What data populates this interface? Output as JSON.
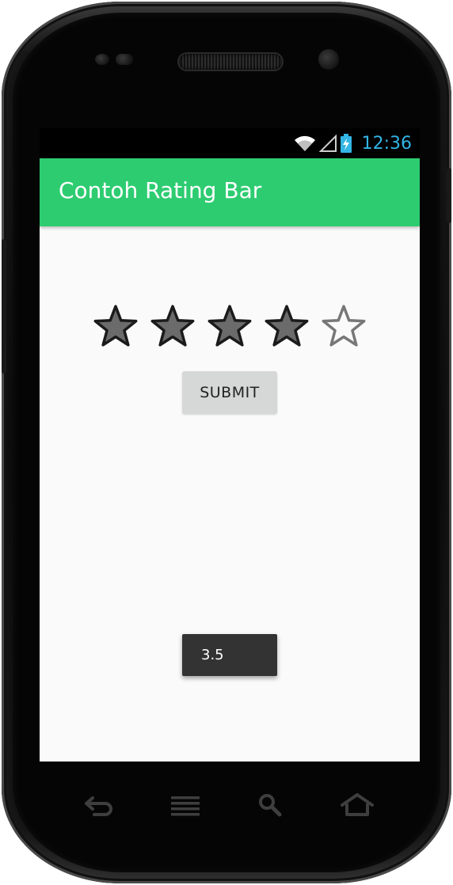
{
  "status_bar": {
    "time": "12:36"
  },
  "app": {
    "title": "Contoh Rating Bar"
  },
  "rating": {
    "value": 4,
    "max": 5
  },
  "submit_button": {
    "label": "SUBMIT"
  },
  "toast": {
    "message": "3.5"
  },
  "colors": {
    "action_bar": "#2ecc71",
    "status_clock": "#33b5e5",
    "star_filled": "#6b6b6b",
    "star_empty_outline": "#777777"
  },
  "nav_keys": [
    "back-icon",
    "menu-icon",
    "search-icon",
    "home-icon"
  ]
}
